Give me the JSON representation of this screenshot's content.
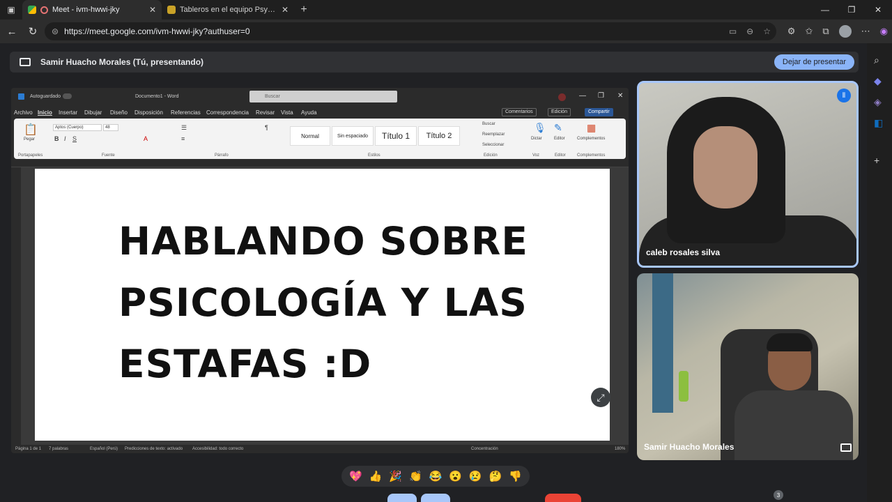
{
  "browser": {
    "tabs": [
      {
        "title": "Meet - ivm-hwwi-jky",
        "active": true
      },
      {
        "title": "Tableros en el equipo Psycrib - M",
        "active": false
      }
    ],
    "url": "https://meet.google.com/ivm-hwwi-jky?authuser=0"
  },
  "meet": {
    "presenting_text": "Samir Huacho Morales (Tú, presentando)",
    "stop_presenting_label": "Dejar de presentar",
    "participants": [
      {
        "name": "caleb rosales silva",
        "speaking": true
      },
      {
        "name": "Samir Huacho Morales",
        "speaking": false
      }
    ],
    "reactions": [
      "💖",
      "👍",
      "🎉",
      "👏",
      "😂",
      "😮",
      "😢",
      "🤔",
      "👎"
    ],
    "participant_count": "3"
  },
  "word": {
    "autosave_label": "Autoguardado",
    "doc_name": "Documento1 - Word",
    "search_placeholder": "Buscar",
    "menu": [
      "Archivo",
      "Inicio",
      "Insertar",
      "Dibujar",
      "Diseño",
      "Disposición",
      "Referencias",
      "Correspondencia",
      "Revisar",
      "Vista",
      "Ayuda"
    ],
    "comments_label": "Comentarios",
    "editing_label": "Edición",
    "share_label": "Compartir",
    "font_name": "Aptos (Cuerpo)",
    "font_size": "48",
    "styles": [
      "Normal",
      "Sin espaciado",
      "Título 1",
      "Título 2"
    ],
    "editing_items": [
      "Buscar",
      "Reemplazar",
      "Seleccionar"
    ],
    "voice_label": "Dictar",
    "editor_label": "Editor",
    "addins_label": "Complementos",
    "groups": [
      "Portapapeles",
      "Fuente",
      "Párrafo",
      "Estilos",
      "Edición",
      "Voz",
      "Editor",
      "Complementos"
    ],
    "paste_label": "Pegar",
    "document_text": [
      "HABLANDO SOBRE",
      "PSICOLOGÍA Y LAS",
      "ESTAFAS :D"
    ],
    "status": {
      "page": "Página 1 de 1",
      "words": "7 palabras",
      "language": "Español (Perú)",
      "predictions": "Predicciones de texto: activado",
      "accessibility": "Accesibilidad: todo correcto",
      "focus": "Concentración",
      "zoom": "180%"
    }
  }
}
